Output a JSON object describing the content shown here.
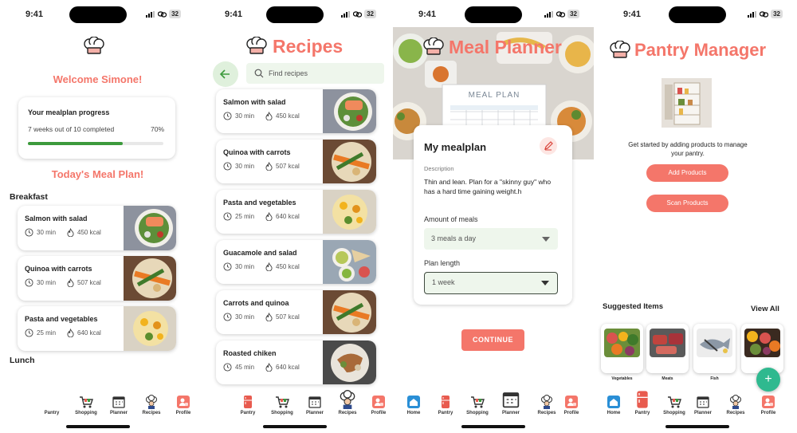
{
  "status": {
    "time": "9:41",
    "battery": "32"
  },
  "home": {
    "welcome": "Welcome Simone!",
    "progress_title": "Your mealplan progress",
    "progress_text": "7 weeks out of 10 completed",
    "progress_percent_label": "70%",
    "progress_value": 0.7,
    "section_title": "Today's Meal Plan!",
    "breakfast_label": "Breakfast",
    "lunch_label": "Lunch",
    "meals": [
      {
        "name": "Salmon with salad",
        "time": "30 min",
        "kcal": "450 kcal"
      },
      {
        "name": "Quinoa with carrots",
        "time": "30 min",
        "kcal": "507 kcal"
      },
      {
        "name": "Pasta and vegetables",
        "time": "25 min",
        "kcal": "640 kcal"
      }
    ],
    "nav": [
      "Pantry",
      "Shopping",
      "Planner",
      "Recipes",
      "Profile"
    ]
  },
  "recipes": {
    "title": "Recipes",
    "search_placeholder": "Find recipes",
    "items": [
      {
        "name": "Salmon with salad",
        "time": "30 min",
        "kcal": "450 kcal"
      },
      {
        "name": "Quinoa with carrots",
        "time": "30 min",
        "kcal": "507 kcal"
      },
      {
        "name": "Pasta and vegetables",
        "time": "25 min",
        "kcal": "640 kcal"
      },
      {
        "name": "Guacamole and salad",
        "time": "30 min",
        "kcal": "450 kcal"
      },
      {
        "name": "Carrots and quinoa",
        "time": "30 min",
        "kcal": "507 kcal"
      },
      {
        "name": "Roasted chiken",
        "time": "45 min",
        "kcal": "640 kcal"
      }
    ],
    "nav": [
      "Pantry",
      "Shopping",
      "Planner",
      "Recipes",
      "Profile"
    ]
  },
  "planner": {
    "title": "Meal Planner",
    "board_text": "MEAL PLAN",
    "card_title": "My mealplan",
    "description_label": "Description",
    "description": "Thin and lean. Plan for a \"skinny guy\" who has a hard time gaining weight.h",
    "amount_label": "Amount of meals",
    "amount_value": "3 meals a day",
    "length_label": "Plan length",
    "length_value": "1 week",
    "continue_label": "CONTINUE",
    "nav": [
      "Home",
      "Pantry",
      "Shopping",
      "Planner",
      "Recipes",
      "Profile"
    ]
  },
  "pantry": {
    "title": "Pantry Manager",
    "intro": "Get started by adding products to manage your pantry.",
    "add_label": "Add Products",
    "scan_label": "Scan Products",
    "suggested_label": "Suggested Items",
    "view_all_label": "View All",
    "fab_label": "+",
    "suggested": [
      "Vegetables",
      "Meats",
      "Fish",
      ""
    ],
    "nav": [
      "Home",
      "Pantry",
      "Shopping",
      "Planner",
      "Recipes",
      "Profile"
    ]
  },
  "colors": {
    "accent": "#f4766a",
    "progress": "#3c9a3c",
    "field_bg": "#eef6ec",
    "fab": "#2fb98f"
  }
}
